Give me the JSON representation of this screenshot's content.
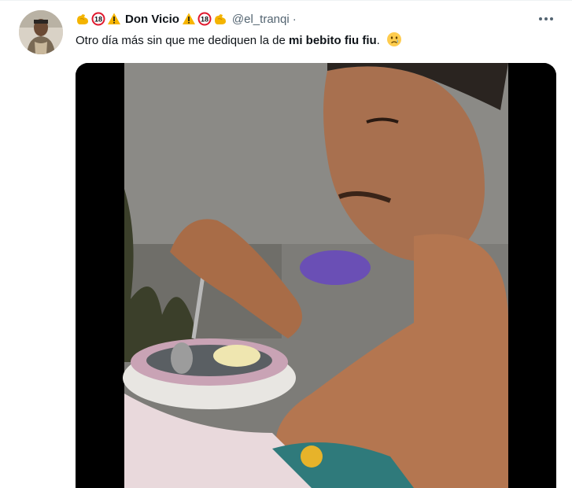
{
  "tweet": {
    "author": {
      "display_name": "Don Vicio",
      "handle": "@el_tranqi",
      "badges_before": [
        "flexed-biceps-emoji",
        "adults-only-18-emoji",
        "warning-emoji"
      ],
      "badges_after": [
        "warning-emoji",
        "adults-only-18-emoji",
        "flexed-biceps-emoji"
      ]
    },
    "separator": "·",
    "text_before": "Otro día más sin que me dediquen la de ",
    "text_bold": "mi bebito fiu fiu",
    "text_after": ".",
    "text_emoji": "crying-face-emoji",
    "more_icon": "more-horizontal-icon",
    "media": {
      "type": "video",
      "description_icon": "video-still"
    }
  },
  "colors": {
    "text_primary": "#0f1419",
    "text_secondary": "#536471",
    "badge_red": "#e0182d",
    "warning_yellow": "#f7b500",
    "muscle_yellow": "#f4b400"
  }
}
